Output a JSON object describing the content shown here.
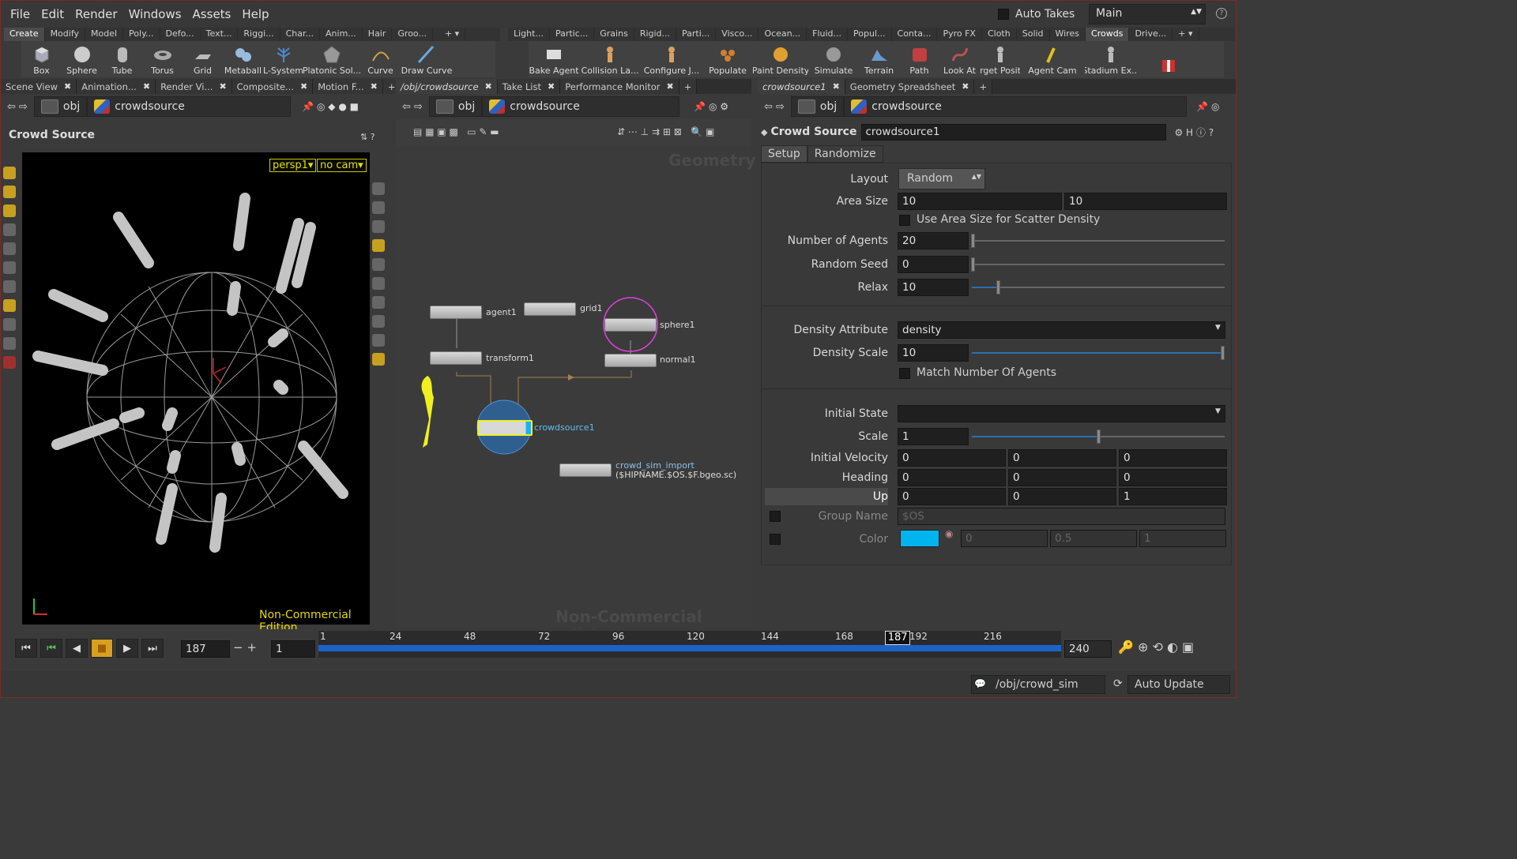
{
  "menus": [
    "File",
    "Edit",
    "Render",
    "Windows",
    "Assets",
    "Help"
  ],
  "auto_takes_label": "Auto Takes",
  "desktop_value": "Main",
  "shelf_tabs_left": [
    "Create",
    "Modify",
    "Model",
    "Poly...",
    "Defo...",
    "Text...",
    "Riggi...",
    "Char...",
    "Anim...",
    "Hair",
    "Groo..."
  ],
  "shelf_tabs_right": [
    "Light...",
    "Partic...",
    "Grains",
    "Rigid...",
    "Parti...",
    "Visco...",
    "Ocean...",
    "Fluid...",
    "Popul...",
    "Conta...",
    "Pyro FX",
    "Cloth",
    "Solid",
    "Wires",
    "Crowds",
    "Drive..."
  ],
  "tools_left": [
    "Box",
    "Sphere",
    "Tube",
    "Torus",
    "Grid",
    "Metaball",
    "L-System",
    "Platonic Sol...",
    "Curve",
    "Draw Curve"
  ],
  "tools_right": [
    "Bake Agent",
    "Collision La...",
    "Configure J...",
    "Populate",
    "Paint Density",
    "Simulate",
    "Terrain",
    "Path",
    "Look At",
    "Target Posit...",
    "Agent Cam",
    "Stadium Ex..."
  ],
  "pane_tabs_left": [
    "Scene View",
    "Animation...",
    "Render Vi...",
    "Composite...",
    "Motion F..."
  ],
  "pane_tabs_mid": [
    "/obj/crowdsource",
    "Take List",
    "Performance Monitor"
  ],
  "pane_tabs_right": [
    "crowdsource1",
    "Geometry Spreadsheet"
  ],
  "path_obj": "obj",
  "path_node": "crowdsource",
  "viewer": {
    "title": "Crowd Source",
    "cam1": "persp1",
    "cam2": "no cam",
    "watermark": "Non-Commercial Edition"
  },
  "network": {
    "context": "Geometry",
    "watermark": "Non-Commercial Edition",
    "nodes": {
      "agent": "agent1",
      "grid": "grid1",
      "sphere": "sphere1",
      "transform": "transform1",
      "normal": "normal1",
      "crowdsource": "crowdsource1",
      "import": "crowd_sim_import",
      "import_sub": "($HIPNAME.$OS.$F.bgeo.sc)"
    }
  },
  "params": {
    "type": "Crowd Source",
    "name": "crowdsource1",
    "tabs": [
      "Setup",
      "Randomize"
    ],
    "layout_label": "Layout",
    "layout_value": "Random",
    "area_label": "Area Size",
    "area_x": "10",
    "area_y": "10",
    "use_area_label": "Use Area Size for Scatter Density",
    "agents_label": "Number of Agents",
    "agents_value": "20",
    "seed_label": "Random Seed",
    "seed_value": "0",
    "relax_label": "Relax",
    "relax_value": "10",
    "density_attr_label": "Density Attribute",
    "density_attr_value": "density",
    "density_scale_label": "Density Scale",
    "density_scale_value": "10",
    "match_label": "Match Number Of Agents",
    "initial_state_label": "Initial State",
    "initial_state_value": "",
    "scale_label": "Scale",
    "scale_value": "1",
    "velocity_label": "Initial Velocity",
    "velocity": [
      "0",
      "0",
      "0"
    ],
    "heading_label": "Heading",
    "heading": [
      "0",
      "0",
      "0"
    ],
    "up_label": "Up",
    "up": [
      "0",
      "0",
      "1"
    ],
    "group_label": "Group Name",
    "group_placeholder": "$OS",
    "color_label": "Color",
    "color_swatch": "#00b4f0",
    "color_vals": [
      "0",
      "0.5",
      "1"
    ]
  },
  "timeline": {
    "frame": "187",
    "step": "1",
    "end": "240",
    "ticks": [
      "1",
      "24",
      "48",
      "72",
      "96",
      "120",
      "144",
      "168",
      "192",
      "216"
    ],
    "current": "187",
    "current_pct": 0.78
  },
  "status": {
    "path": "/obj/crowd_sim",
    "update": "Auto Update"
  }
}
